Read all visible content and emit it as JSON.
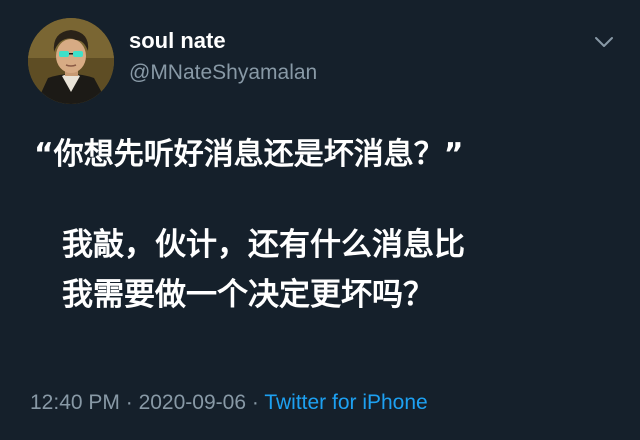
{
  "tweet": {
    "display_name": "soul nate",
    "handle": "@MNateShyamalan",
    "lines": [
      "“你想先听好消息还是坏消息？”",
      "我敲，伙计，还有什么消息比",
      "我需要做一个决定更坏吗？"
    ],
    "time": "12:40 PM",
    "separator": "·",
    "date": "2020-09-06",
    "source": "Twitter for iPhone"
  },
  "colors": {
    "background": "#15202b",
    "text": "#ffffff",
    "secondary": "#8899a6",
    "link": "#1da1f2"
  },
  "icons": {
    "menu": "chevron-down-icon",
    "avatar": "avatar"
  }
}
